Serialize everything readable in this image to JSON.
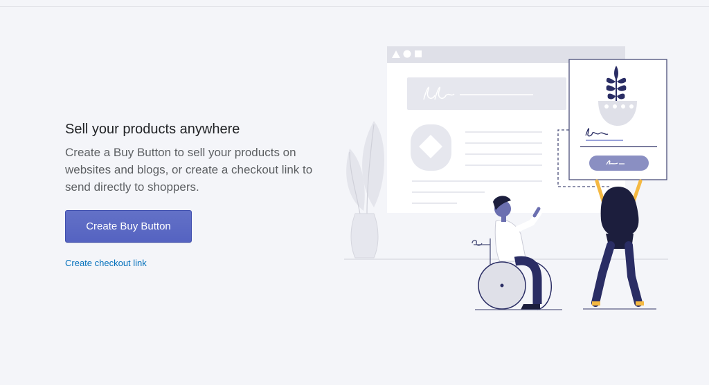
{
  "empty_state": {
    "heading": "Sell your products anywhere",
    "description": "Create a Buy Button to sell your products on websites and blogs, or create a checkout link to send directly to shoppers.",
    "primary_action_label": "Create Buy Button",
    "secondary_action_label": "Create checkout link"
  },
  "illustration": {
    "browser_icons": [
      "triangle-icon",
      "circle-icon",
      "square-icon"
    ],
    "colors": {
      "accent": "#5c6ac4",
      "navy": "#2a2d64",
      "light_gray": "#dfe0e8",
      "skin_mustard": "#f5b942"
    }
  },
  "colors": {
    "background": "#f4f5f9",
    "primary_button": "#5c6ac4",
    "link": "#006fbb",
    "heading": "#212326",
    "body_text": "#5c5f62"
  }
}
